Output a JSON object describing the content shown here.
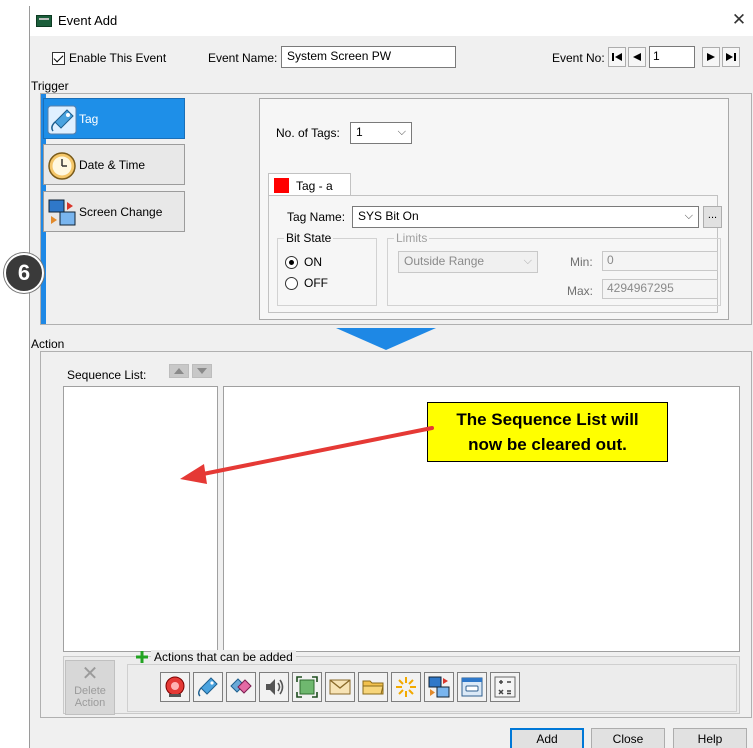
{
  "window": {
    "title": "Event Add"
  },
  "header": {
    "enable_label": "Enable This Event",
    "event_name_label": "Event Name:",
    "event_name_value": "System Screen PW",
    "event_no_label": "Event No:",
    "event_no_value": "1"
  },
  "trigger": {
    "section_label": "Trigger",
    "buttons": [
      {
        "label": "Tag",
        "icon": "tag-icon"
      },
      {
        "label": "Date & Time",
        "icon": "clock-icon"
      },
      {
        "label": "Screen Change",
        "icon": "screen-change-icon"
      }
    ],
    "no_of_tags_label": "No. of Tags:",
    "no_of_tags_value": "1",
    "tab_label": "Tag - a",
    "tag_name_label": "Tag Name:",
    "tag_name_value": "SYS Bit On",
    "browse_label": "...",
    "bit_state": {
      "title": "Bit State",
      "on_label": "ON",
      "off_label": "OFF",
      "selected": "ON"
    },
    "limits": {
      "title": "Limits",
      "range_value": "Outside Range",
      "min_label": "Min:",
      "min_value": "0",
      "max_label": "Max:",
      "max_value": "4294967295"
    }
  },
  "action": {
    "section_label": "Action",
    "sequence_list_label": "Sequence List:",
    "delete_label_1": "Delete",
    "delete_label_2": "Action",
    "available_label": "Actions that can be added",
    "action_icons": [
      "alarm-icon",
      "tag-write-icon",
      "tag-copy-icon",
      "sound-icon",
      "screen-capture-icon",
      "email-icon",
      "folder-icon",
      "flash-icon",
      "screen-switch-icon",
      "window-icon",
      "calculation-icon"
    ]
  },
  "buttons": {
    "add": "Add",
    "close": "Close",
    "help": "Help"
  },
  "annotations": {
    "step_number": "6",
    "callout_line1": "The Sequence List will",
    "callout_line2": "now be cleared out."
  },
  "colors": {
    "active_trigger": "#1e8fe8",
    "callout": "#ffff00",
    "arrow": "#e53935",
    "flow_arrow": "#1e88e5",
    "tag_swatch": "#ff0000"
  }
}
